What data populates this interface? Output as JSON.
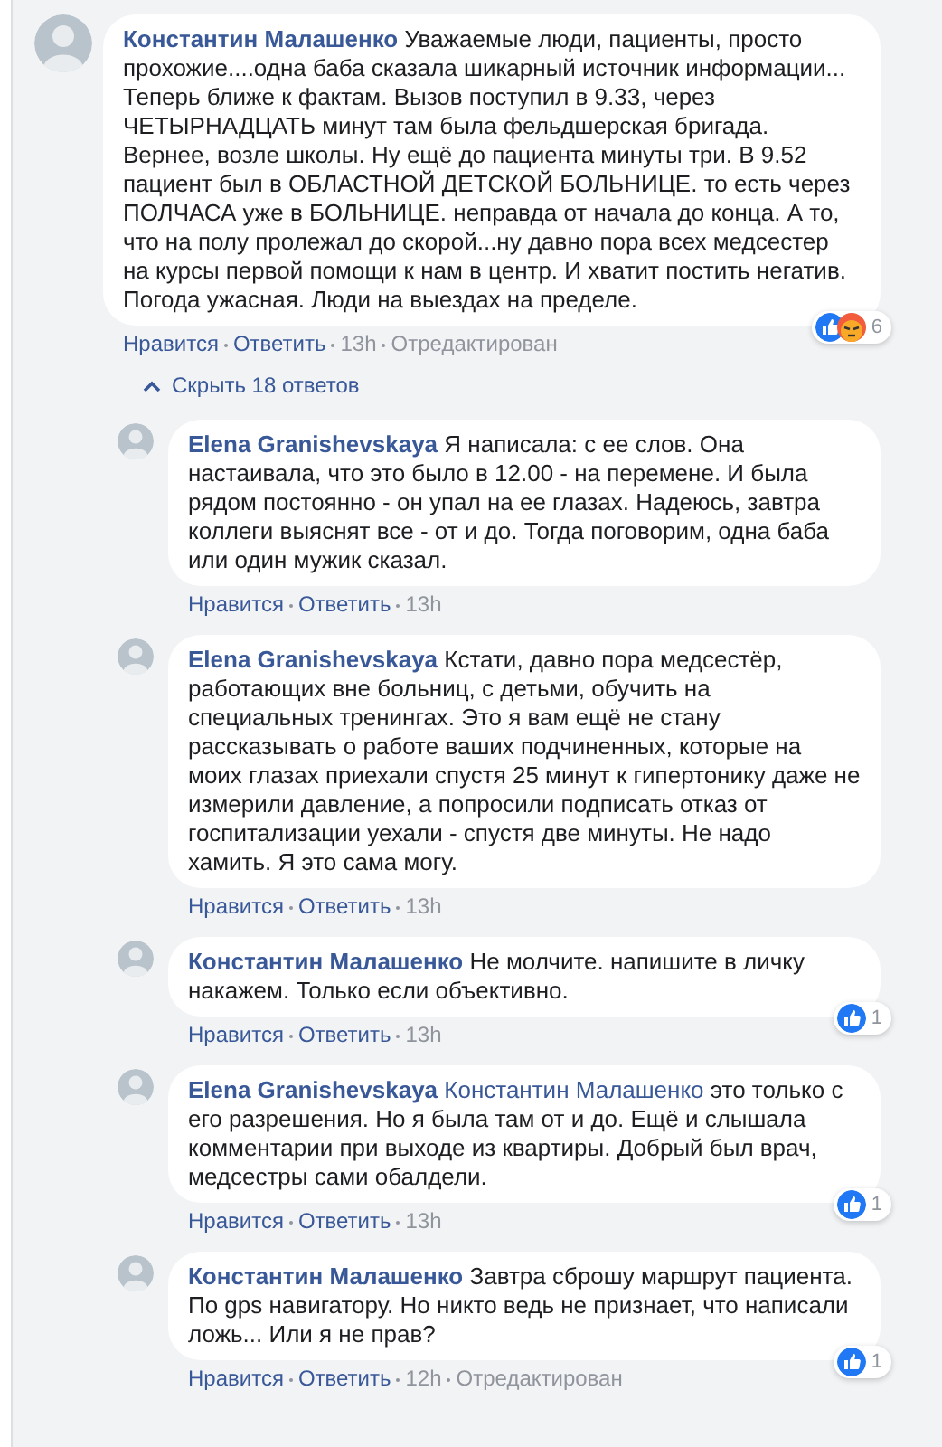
{
  "comment": {
    "author": "Константин Малашенко",
    "text": "Уважаемые люди, пациенты, просто прохожие....одна баба сказала шикарный источник информации... Теперь ближе к фактам. Вызов поступил в 9.33, через ЧЕТЫРНАДЦАТЬ минут там была фельдшерская бригада. Вернее, возле школы. Ну ещё до пациента минуты три. В 9.52 пациент был в ОБЛАСТНОЙ ДЕТСКОЙ БОЛЬНИЦЕ. то есть через ПОЛЧАСА уже в БОЛЬНИЦЕ. неправда от начала до конца. А то, что на полу пролежал до скорой...ну давно пора всех медсестер на курсы первой помощи к нам в центр. И хватит постить негатив. Погода ужасная. Люди на выездах на пределе.",
    "reactions": [
      {
        "kind": "like"
      },
      {
        "kind": "angry"
      }
    ],
    "reaction_count": "6",
    "like": "Нравится",
    "reply": "Ответить",
    "time": "13h",
    "edited": "Отредактирован"
  },
  "toggle": {
    "label": "Скрыть 18 ответов",
    "expanded": true
  },
  "replies": [
    {
      "author": "Elena Granishevskaya",
      "text": "Я написала: с ее слов. Она настаивала, что это было в 12.00 - на перемене. И была рядом постоянно - он упал на ее глазах. Надеюсь, завтра коллеги выяснят все - от и до. Тогда поговорим, одна баба или один мужик сказал.",
      "like": "Нравится",
      "reply": "Ответить",
      "time": "13h"
    },
    {
      "author": "Elena Granishevskaya",
      "text": "Кстати, давно пора медсестёр, работающих вне больниц, с детьми, обучить на специальных тренингах. Это я вам ещё не стану рассказывать о работе ваших подчиненных, которые на моих глазах приехали спустя 25 минут к гипертонику даже не измерили давление, а попросили подписать отказ от госпитализации уехали - спустя две минуты. Не надо хамить. Я это сама могу.",
      "like": "Нравится",
      "reply": "Ответить",
      "time": "13h"
    },
    {
      "author": "Константин Малашенко",
      "text": "Не молчите. напишите в личку накажем. Только если объективно.",
      "reactions": [
        {
          "kind": "like"
        }
      ],
      "reaction_count": "1",
      "like": "Нравится",
      "reply": "Ответить",
      "time": "13h"
    },
    {
      "author": "Elena Granishevskaya",
      "mention": "Константин Малашенко",
      "text": "это только с его разрешения. Но я была там от и до. Ещё и слышала комментарии при выходе из квартиры. Добрый был врач, медсестры сами обалдели.",
      "reactions": [
        {
          "kind": "like"
        }
      ],
      "reaction_count": "1",
      "like": "Нравится",
      "reply": "Ответить",
      "time": "13h"
    },
    {
      "author": "Константин Малашенко",
      "text": "Завтра сброшу маршрут пациента. По gps навигатору. Но никто ведь не признает, что написали ложь... Или я не прав?",
      "reactions": [
        {
          "kind": "like"
        }
      ],
      "reaction_count": "1",
      "like": "Нравится",
      "reply": "Ответить",
      "time": "12h",
      "edited": "Отредактирован"
    }
  ]
}
